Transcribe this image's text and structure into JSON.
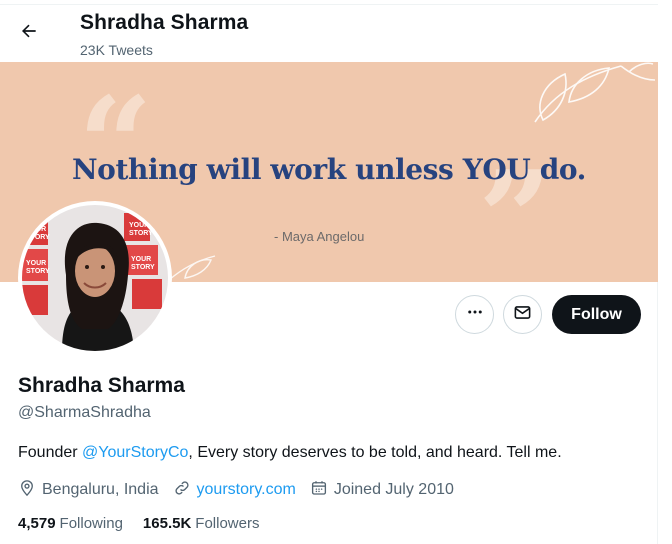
{
  "header": {
    "name": "Shradha Sharma",
    "tweets": "23K Tweets"
  },
  "banner": {
    "quote": "Nothing will work unless YOU do.",
    "author": "- Maya Angelou"
  },
  "actions": {
    "follow_label": "Follow"
  },
  "profile": {
    "name": "Shradha Sharma",
    "handle": "@SharmaShradha",
    "bio_prefix": "Founder ",
    "bio_mention": "@YourStoryCo",
    "bio_suffix": ", Every story deserves to be told, and heard. Tell me.",
    "location": "Bengaluru, India",
    "website": "yourstory.com",
    "joined": "Joined July 2010"
  },
  "stats": {
    "following_count": "4,579",
    "following_label": "Following",
    "followers_count": "165.5K",
    "followers_label": "Followers"
  },
  "icons": {
    "back": "arrow-left-icon",
    "more": "more-dots-icon",
    "message": "envelope-icon",
    "location": "location-pin-icon",
    "link": "link-icon",
    "calendar": "calendar-icon"
  },
  "colors": {
    "banner_bg": "#f0c8ad",
    "quote_text": "#27437f",
    "link": "#1d9bf0",
    "follow_bg": "#0f1419",
    "secondary_text": "#536471"
  }
}
